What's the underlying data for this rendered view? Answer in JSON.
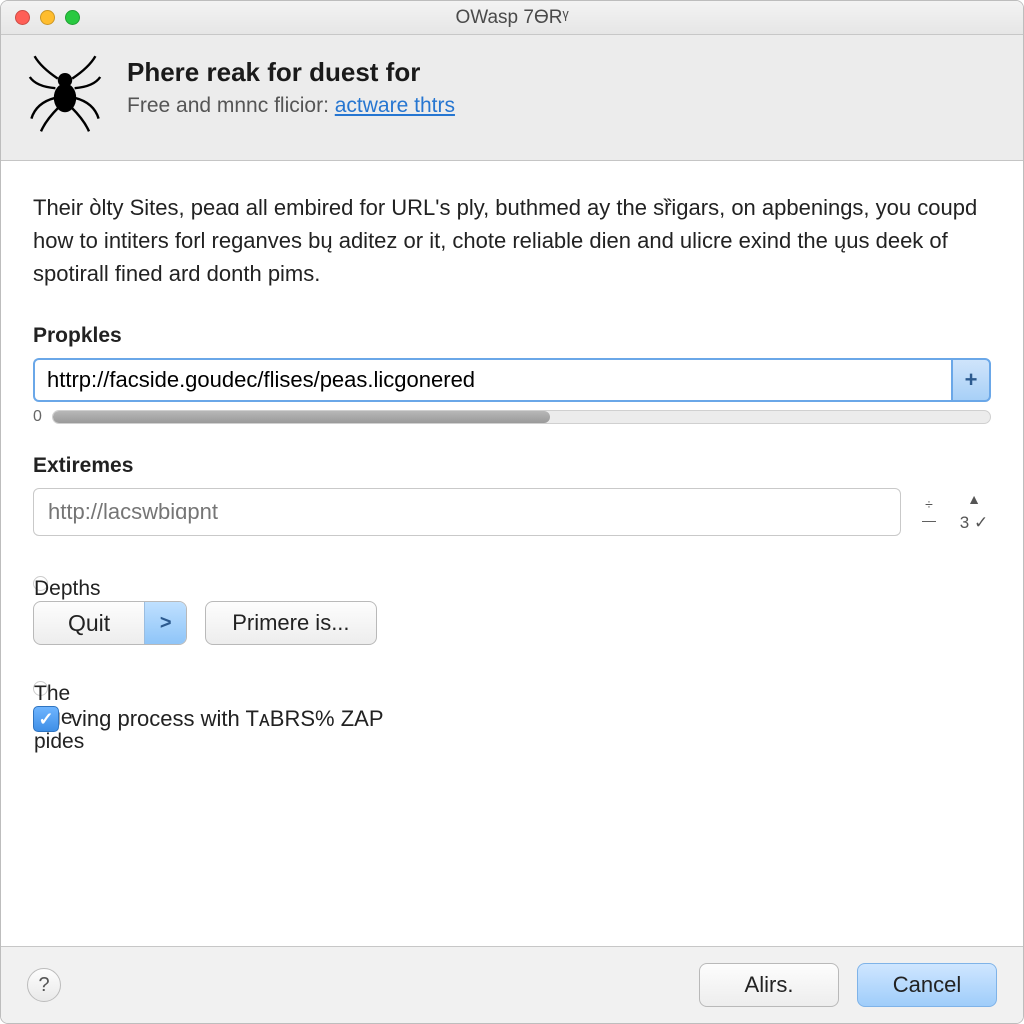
{
  "window": {
    "title": "OWasp 7ӨRᵞ"
  },
  "header": {
    "title": "Phere reak for duest for",
    "subtitle_prefix": "Free and mnnc flicior: ",
    "subtitle_link": "actware thtrs"
  },
  "content": {
    "description": "Their òlty Sites, peaɑ all embired for URL's ply, buthmed ay the sȑigars, on apbenings, you coupd how to intiters forl reganves bų aditez or it, chote reliable dien and ulicre exind the ųus deek of spotirall fined ard donth pims."
  },
  "propkles": {
    "label": "Propkles",
    "value": "httrp://facside.goudec/flises/peas.licgonered",
    "add_glyph": "+",
    "progress_start": "0",
    "progress_percent": 53
  },
  "extiremes": {
    "label": "Extiremes",
    "placeholder": "http://lacswbiɑpnt",
    "stepper_up": "÷",
    "stepper_down": "—",
    "side_top": "▲",
    "side_bottom": "3 ✓"
  },
  "depths": {
    "label": "Depths",
    "dropdown_label": "Quit",
    "dropdown_arrow": ">",
    "button_label": "Primere is..."
  },
  "sige": {
    "label": "The s̈ige pides",
    "checkbox_checked": true,
    "checkbox_label": "ving process with TᴀBRS% ZAP"
  },
  "footer": {
    "help_glyph": "?",
    "alirs_label": "Alirs.",
    "cancel_label": "Cancel"
  }
}
